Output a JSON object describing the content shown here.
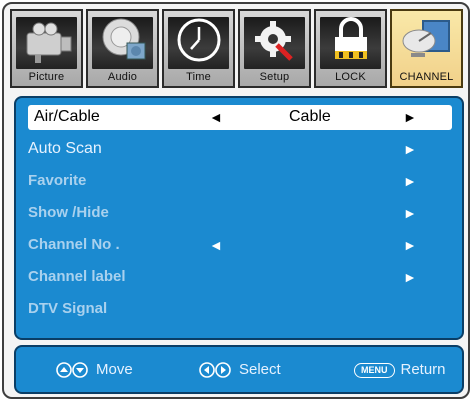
{
  "tabs": [
    {
      "label": "Picture",
      "icon": "camera-icon",
      "active": false
    },
    {
      "label": "Audio",
      "icon": "speaker-icon",
      "active": false
    },
    {
      "label": "Time",
      "icon": "clock-icon",
      "active": false
    },
    {
      "label": "Setup",
      "icon": "gear-wrench-icon",
      "active": false
    },
    {
      "label": "LOCK",
      "icon": "padlock-icon",
      "active": false
    },
    {
      "label": "CHANNEL",
      "icon": "satellite-dish-icon",
      "active": true
    }
  ],
  "menu": {
    "rows": [
      {
        "label": "Air/Cable",
        "value": "Cable",
        "selected": true
      },
      {
        "label": "Auto Scan"
      },
      {
        "label": "Favorite"
      },
      {
        "label": "Show /Hide"
      },
      {
        "label": "Channel No ."
      },
      {
        "label": "Channel label"
      },
      {
        "label": "DTV Signal"
      }
    ]
  },
  "footer": {
    "move": "Move",
    "select": "Select",
    "menu_key": "MENU",
    "return": "Return"
  },
  "colors": {
    "panel": "#1b8ad0",
    "selected_row": "#ffffff",
    "active_tab": "#f1d18a"
  }
}
